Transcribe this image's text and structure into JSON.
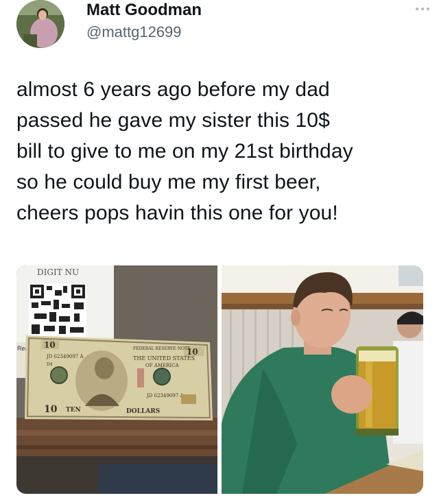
{
  "tweet": {
    "author": {
      "display_name": "Matt Goodman",
      "handle": "@mattg12699"
    },
    "more_icon": "more-dots-icon",
    "text": "almost 6 years ago before my dad\npassed he gave my sister this 10$\nbill to give to me on my 21st birthday\nso he could buy me my first beer,\ncheers pops havin this one for you!"
  },
  "media": {
    "photo1": {
      "sign_text": "DIGIT    NU",
      "bill": {
        "tag": "Read",
        "serial_top": "JD 62349097 A",
        "series_code": "D4",
        "reserve_note": "FEDERAL RESERVE NOTE",
        "country_line1": "THE UNITED STATES",
        "country_line2": "OF AMERICA",
        "serial_bottom": "JD 62349097 A",
        "denomination_word": "TEN",
        "denomination_plural": "DOLLARS",
        "number": "10"
      }
    },
    "photo2": {}
  }
}
